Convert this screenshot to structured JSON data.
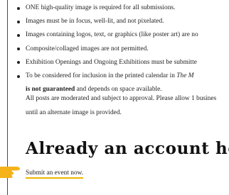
{
  "guidelines": {
    "bullets": [
      "ONE high-quality image is required for all submissions.",
      "Images must be in focus, well-lit, and not pixelated.",
      "Images containing logos, text, or graphics (like poster art) are no",
      "Composite/collaged images are not permitted.",
      "Exhibition Openings and Ongoing Exhibitions must be submitte",
      "To be considered for inclusion in the printed calendar in "
    ],
    "calendar_publication": "The M",
    "continuation_bold": "is not guaranteed",
    "continuation_rest": " and depends on space available."
  },
  "moderation_note": {
    "line1": "All posts are moderated and subject to approval. Please allow 1 busines",
    "line2": "until an alternate image is provided."
  },
  "account_section": {
    "heading": "Already an account holder?",
    "submit_link": "Submit an event now."
  },
  "colors": {
    "link_underline": "#f0b400",
    "pointer_hand": "#f5b21a"
  },
  "icons": {
    "pointer": "pointing-hand-icon"
  }
}
